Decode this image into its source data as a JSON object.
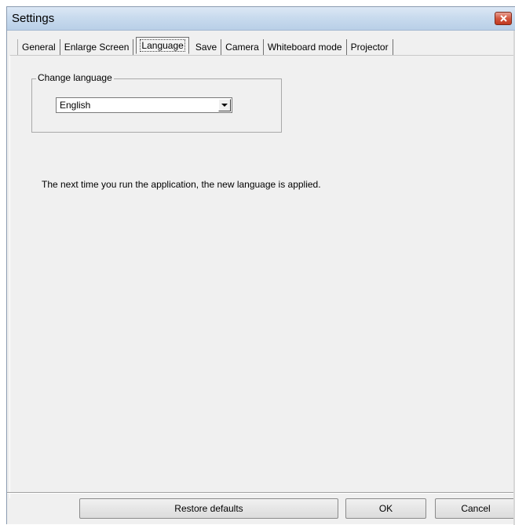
{
  "window": {
    "title": "Settings",
    "close_icon": "close-icon",
    "accent_color": "#c8412a"
  },
  "tabs": [
    {
      "label": "General",
      "active": false
    },
    {
      "label": "Enlarge Screen",
      "active": false
    },
    {
      "label": "Language",
      "active": true
    },
    {
      "label": "Save",
      "active": false
    },
    {
      "label": "Camera",
      "active": false
    },
    {
      "label": "Whiteboard mode",
      "active": false
    },
    {
      "label": "Projector",
      "active": false
    }
  ],
  "language_group": {
    "legend": "Change language",
    "selected_language": "English",
    "dropdown_icon": "chevron-down-icon"
  },
  "info": {
    "message": "The next time you run the application, the new language is applied."
  },
  "footer": {
    "restore_label": "Restore defaults",
    "ok_label": "OK",
    "cancel_label": "Cancel"
  }
}
